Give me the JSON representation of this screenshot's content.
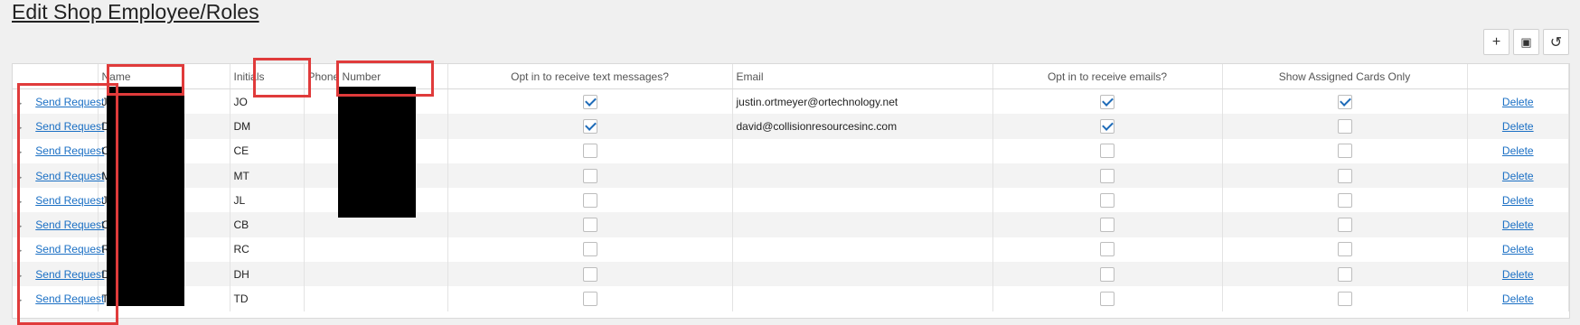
{
  "page": {
    "title": "Edit Shop Employee/Roles"
  },
  "toolbar": [
    {
      "name": "add-button",
      "icon": "plus-icon",
      "glyph": "+"
    },
    {
      "name": "save-button",
      "icon": "save-icon",
      "glyph": "▣"
    },
    {
      "name": "undo-button",
      "icon": "undo-icon",
      "glyph": "↺"
    }
  ],
  "columns": [
    "",
    "Name",
    "Initials",
    "Phone Number",
    "Opt in to receive text messages?",
    "Email",
    "Opt in to receive emails?",
    "Show Assigned Cards Only",
    ""
  ],
  "action_label": "Send Request",
  "delete_label": "Delete",
  "rows": [
    {
      "name": "J",
      "initials": "JO",
      "phone": "",
      "text_opt": true,
      "email": "justin.ortmeyer@ortechnology.net",
      "email_opt": true,
      "assigned_only": true
    },
    {
      "name": "D",
      "initials": "DM",
      "phone": "",
      "text_opt": true,
      "email": "david@collisionresourcesinc.com",
      "email_opt": true,
      "assigned_only": false
    },
    {
      "name": "C",
      "initials": "CE",
      "phone": "",
      "text_opt": false,
      "email": "",
      "email_opt": false,
      "assigned_only": false
    },
    {
      "name": "M",
      "initials": "MT",
      "phone": "",
      "text_opt": false,
      "email": "",
      "email_opt": false,
      "assigned_only": false
    },
    {
      "name": "J",
      "initials": "JL",
      "phone": "",
      "text_opt": false,
      "email": "",
      "email_opt": false,
      "assigned_only": false
    },
    {
      "name": "C",
      "initials": "CB",
      "phone": "",
      "text_opt": false,
      "email": "",
      "email_opt": false,
      "assigned_only": false
    },
    {
      "name": "R",
      "initials": "RC",
      "phone": "",
      "text_opt": false,
      "email": "",
      "email_opt": false,
      "assigned_only": false
    },
    {
      "name": "D",
      "initials": "DH",
      "phone": "",
      "text_opt": false,
      "email": "",
      "email_opt": false,
      "assigned_only": false
    },
    {
      "name": "T",
      "initials": "TD",
      "phone": "",
      "text_opt": false,
      "email": "",
      "email_opt": false,
      "assigned_only": false
    }
  ],
  "colors": {
    "link": "#1a6fc4",
    "highlight": "#e03b3b",
    "check": "#1e6bb8"
  }
}
